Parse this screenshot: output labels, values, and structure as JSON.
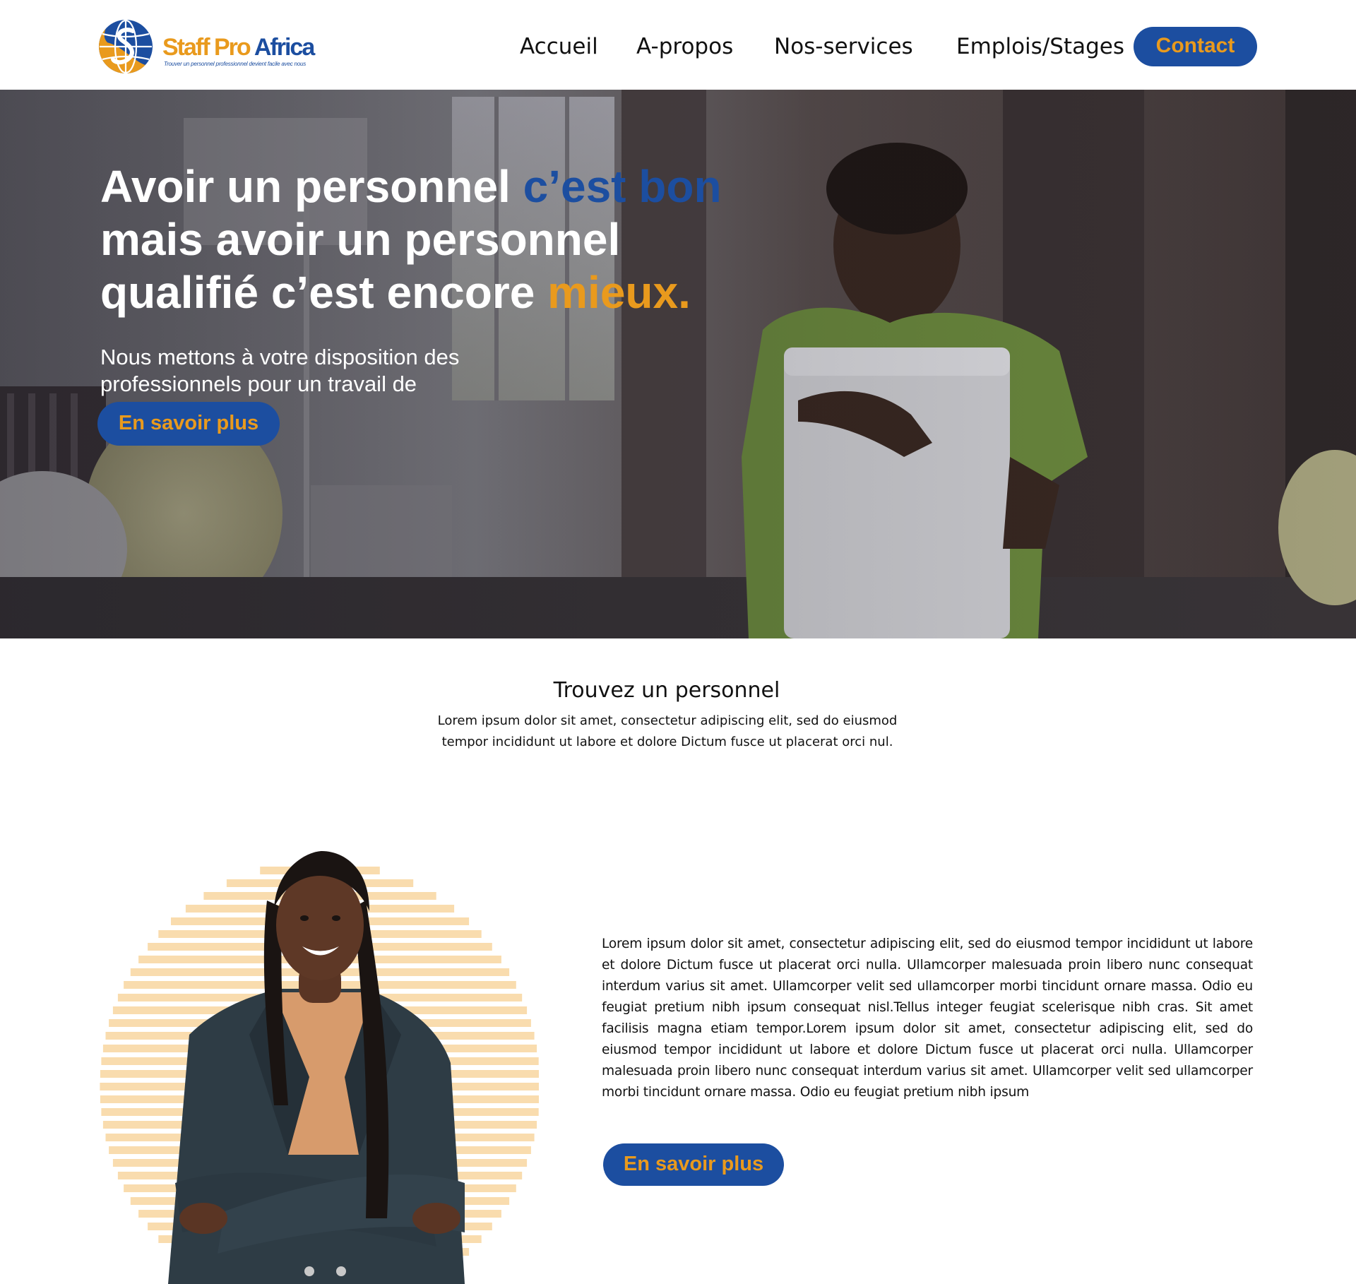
{
  "brand": {
    "name_part1": "Staff Pro",
    "name_part2": "Africa",
    "tagline": "Trouver un personnel professionnel devient facile avec nous"
  },
  "nav": {
    "items": [
      "Accueil",
      "A-propos",
      "Nos-services",
      "Emplois/Stages"
    ],
    "contact_label": "Contact"
  },
  "hero": {
    "title_part1": "Avoir un personnel ",
    "title_highlight_blue": "c’est bon",
    "title_part2": " mais avoir un personnel qualifié c’est encore ",
    "title_highlight_orange": "mieux.",
    "subtitle": "Nous mettons à votre disposition des professionnels pour un travail de qualité.",
    "cta_label": "En savoir plus"
  },
  "find_section": {
    "title": "Trouvez un personnel",
    "text": "Lorem ipsum dolor sit amet, consectetur adipiscing elit, sed do eiusmod tempor incididunt ut labore et dolore  Dictum fusce ut placerat orci nul."
  },
  "feature": {
    "text": "Lorem ipsum dolor sit amet, consectetur adipiscing elit, sed do eiusmod tempor incididunt ut labore et dolore Dictum fusce ut placerat orci nulla. Ullamcorper malesuada proin libero nunc consequat interdum varius sit amet. Ullamcorper velit sed ullamcorper morbi tincidunt ornare massa. Odio eu feugiat pretium nibh ipsum consequat nisl.Tellus integer feugiat scelerisque nibh cras. Sit amet facilisis magna etiam tempor.Lorem ipsum dolor sit amet, consectetur adipiscing elit, sed do eiusmod tempor incididunt ut labore et dolore Dictum fusce ut placerat orci nulla. Ullamcorper malesuada proin libero nunc consequat interdum varius sit amet. Ullamcorper velit sed ullamcorper morbi tincidunt ornare massa. Odio eu feugiat pretium nibh ipsum",
    "cta_label": "En savoir plus"
  },
  "colors": {
    "brand_blue": "#1c4ea0",
    "brand_orange": "#e99a1d",
    "stripe_peach": "#f9dcae"
  }
}
